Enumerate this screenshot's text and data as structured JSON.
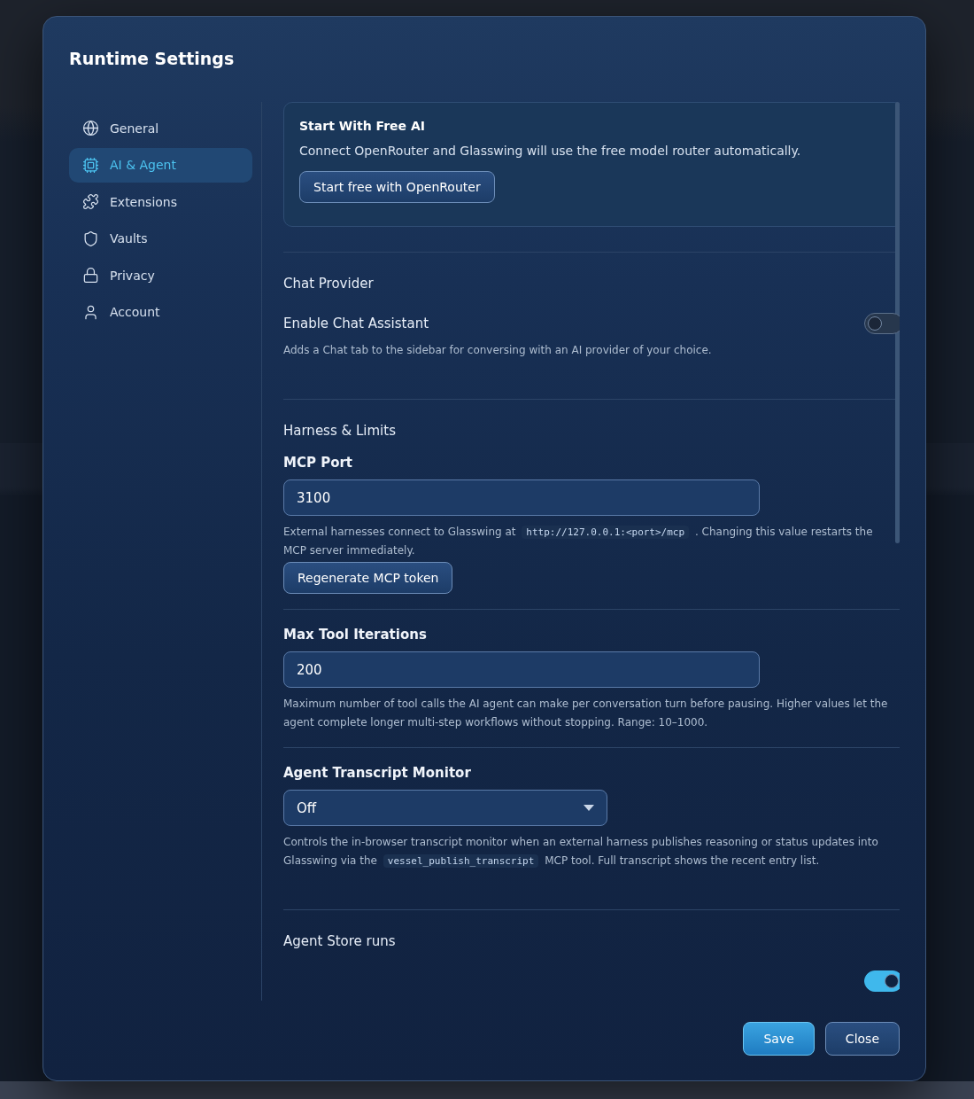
{
  "dialog": {
    "title": "Runtime Settings"
  },
  "sidebar": {
    "items": [
      {
        "label": "General",
        "selected": false
      },
      {
        "label": "AI & Agent",
        "selected": true
      },
      {
        "label": "Extensions",
        "selected": false
      },
      {
        "label": "Vaults",
        "selected": false
      },
      {
        "label": "Privacy",
        "selected": false
      },
      {
        "label": "Account",
        "selected": false
      }
    ]
  },
  "promo": {
    "title": "Start With Free AI",
    "text": "Connect OpenRouter and Glasswing will use the free model router automatically.",
    "button": "Start free with OpenRouter"
  },
  "sections": [
    {
      "kind": "toggle",
      "heading": "Chat Provider",
      "label": "Enable Chat Assistant",
      "on": false,
      "help": [
        {
          "text": "Adds a Chat tab to the sidebar for conversing with an AI provider of your choice."
        }
      ]
    },
    {
      "kind": "group",
      "heading": "Harness & Limits"
    },
    {
      "kind": "input",
      "label": "MCP Port",
      "value": "3100",
      "help": [
        {
          "text": "External harnesses connect to Glasswing at "
        },
        {
          "code": "http://127.0.0.1:<port>/mcp"
        },
        {
          "text": " . Changing this value restarts the MCP server immediately."
        }
      ],
      "button": "Regenerate MCP token"
    },
    {
      "kind": "input",
      "label": "Max Tool Iterations",
      "value": "200",
      "help": [
        {
          "text": "Maximum number of tool calls the AI agent can make per conversation turn before pausing. Higher values let the agent complete longer multi-step workflows without stopping. Range: 10–1000."
        }
      ]
    },
    {
      "kind": "select",
      "label": "Agent Transcript Monitor",
      "value": "Off",
      "help": [
        {
          "text": "Controls the in-browser transcript monitor when an external harness publishes reasoning or status updates into Glasswing via the "
        },
        {
          "code": "vessel_publish_transcript"
        },
        {
          "text": " MCP tool. Full transcript shows the recent entry list."
        }
      ]
    },
    {
      "kind": "toggle",
      "heading": "Agent Store runs",
      "on": true
    }
  ],
  "footer": {
    "buttons": [
      {
        "label": "Save",
        "kind": "primary"
      },
      {
        "label": "Close",
        "kind": "secondary"
      }
    ]
  }
}
